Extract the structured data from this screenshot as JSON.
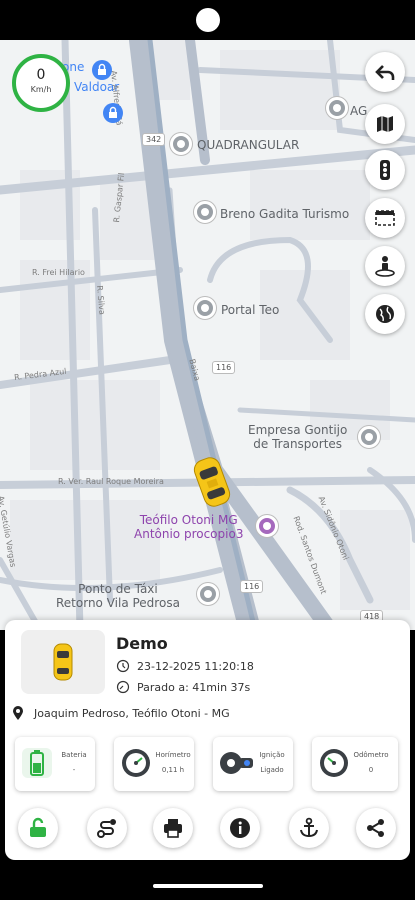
{
  "speedometer": {
    "value": "0",
    "unit": "Km/h"
  },
  "map": {
    "pois": [
      {
        "label": "one",
        "style": "blue"
      },
      {
        "label": "Valdoar",
        "style": "blue"
      },
      {
        "label": "AG",
        "style": "gray"
      },
      {
        "label": "QUADRANGULAR",
        "style": "gray"
      },
      {
        "label": "Breno Gadita Turismo",
        "style": "gray"
      },
      {
        "label": "Portal Teo",
        "style": "gray"
      },
      {
        "label": "Empresa Gontijo\nde Transportes",
        "style": "gray"
      },
      {
        "label": "Teófilo Otoni MG\nAntônio procopio3",
        "style": "purple"
      },
      {
        "label": "Ponto de Táxi\nRetorno Vila Pedrosa",
        "style": "gray"
      }
    ],
    "streets": [
      "Av. Alfredo Sá",
      "R. Frei Hilario",
      "R. Pedra Azul",
      "R. Ver. Raul Roque Moreira",
      "Av. Getúlio Vargas",
      "Rod. Santos Dumont",
      "Av. Sidônio Otoni",
      "Baixa",
      "R. Silva",
      "R. Gaspar Fil"
    ],
    "shields": [
      "342",
      "116",
      "116",
      "418"
    ]
  },
  "map_buttons": [
    "back-arrow-icon",
    "map-icon",
    "traffic-light-icon",
    "fence-icon",
    "street-view-icon",
    "globe-icon"
  ],
  "vehicle": {
    "name": "Demo",
    "datetime": "23-12-2025 11:20:18",
    "stopped": "Parado a: 41min 37s",
    "address": "Joaquim Pedroso, Teófilo Otoni - MG"
  },
  "stats": [
    {
      "label": "Bateria",
      "value": "-"
    },
    {
      "label": "Horímetro",
      "value": "0,11 h"
    },
    {
      "label": "Ignição",
      "value": "Ligado"
    },
    {
      "label": "Odômetro",
      "value": "0"
    }
  ],
  "actions": [
    "unlock-icon",
    "route-icon",
    "print-icon",
    "info-icon",
    "anchor-icon",
    "share-icon"
  ],
  "colors": {
    "accent_green": "#2fb344",
    "car_yellow": "#f5c518",
    "map_bg": "#f1f3f4",
    "road": "#c7ced8"
  }
}
